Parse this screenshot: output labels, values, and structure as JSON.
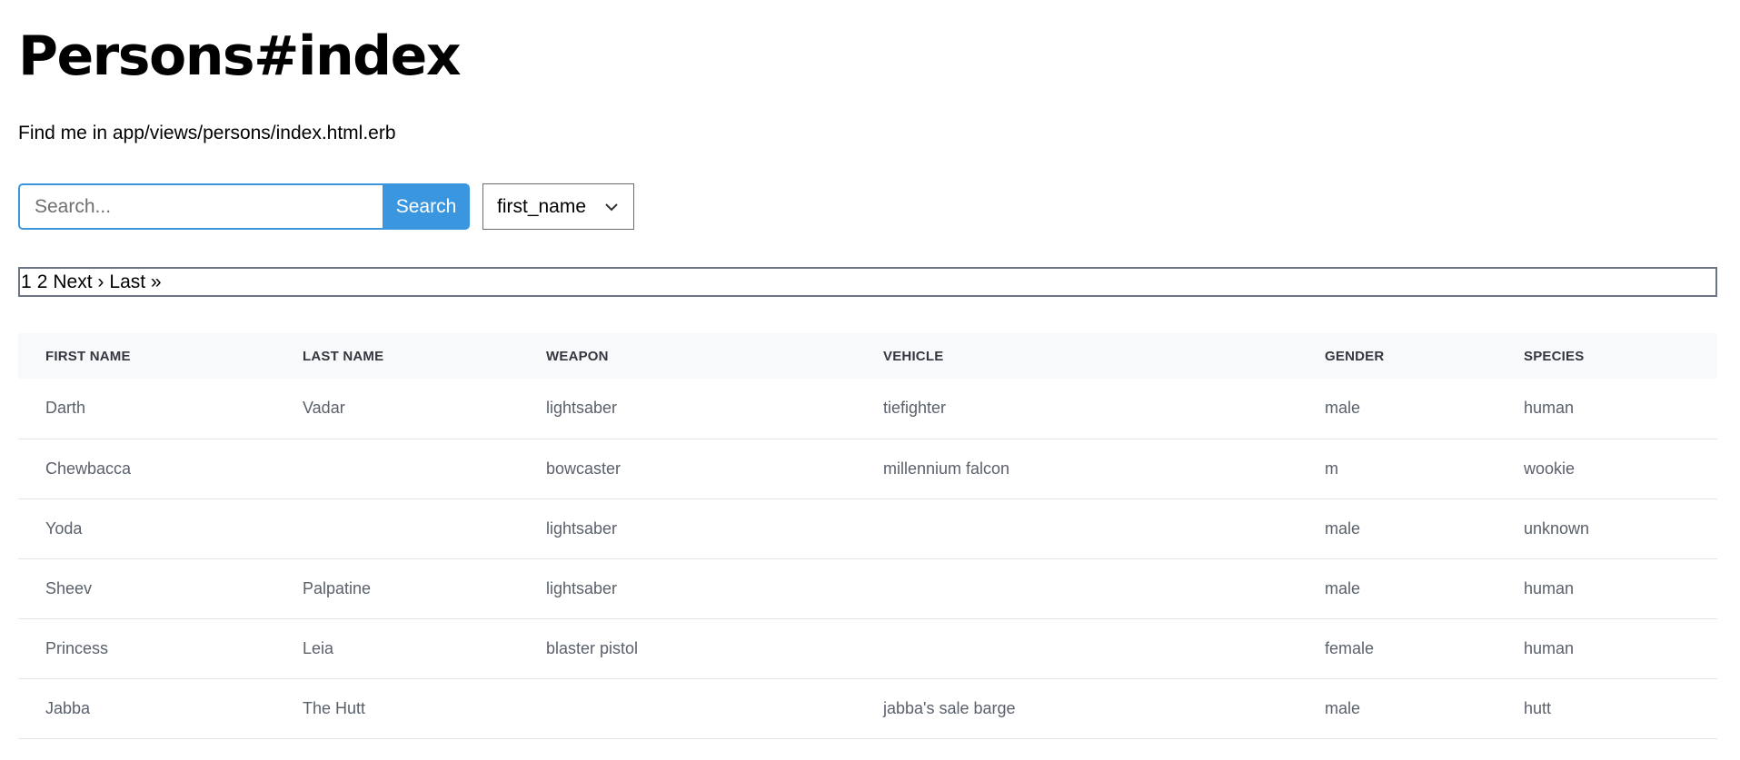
{
  "page": {
    "title": "Persons#index",
    "subtitle": "Find me in app/views/persons/index.html.erb"
  },
  "search": {
    "placeholder": "Search...",
    "value": "",
    "button_label": "Search"
  },
  "sort_select": {
    "selected": "first_name"
  },
  "pagination": {
    "page_1": "1",
    "page_2": "2",
    "next": "Next ›",
    "last": "Last »"
  },
  "table": {
    "headers": [
      "FIRST NAME",
      "LAST NAME",
      "WEAPON",
      "VEHICLE",
      "GENDER",
      "SPECIES"
    ],
    "rows": [
      [
        "Darth",
        "Vadar",
        "lightsaber",
        "tiefighter",
        "male",
        "human"
      ],
      [
        "Chewbacca",
        "",
        "bowcaster",
        "millennium falcon",
        "m",
        "wookie"
      ],
      [
        "Yoda",
        "",
        "lightsaber",
        "",
        "male",
        "unknown"
      ],
      [
        "Sheev",
        "Palpatine",
        "lightsaber",
        "",
        "male",
        "human"
      ],
      [
        "Princess",
        "Leia",
        "blaster pistol",
        "",
        "female",
        "human"
      ],
      [
        "Jabba",
        "The Hutt",
        "",
        "jabba's sale barge",
        "male",
        "hutt"
      ]
    ]
  },
  "colors": {
    "accent": "#3b96e0",
    "table_header_bg": "#f8f9fa",
    "row_divider": "#e3e5e8"
  },
  "icons": {
    "select_arrow": "chevron-down-icon"
  }
}
